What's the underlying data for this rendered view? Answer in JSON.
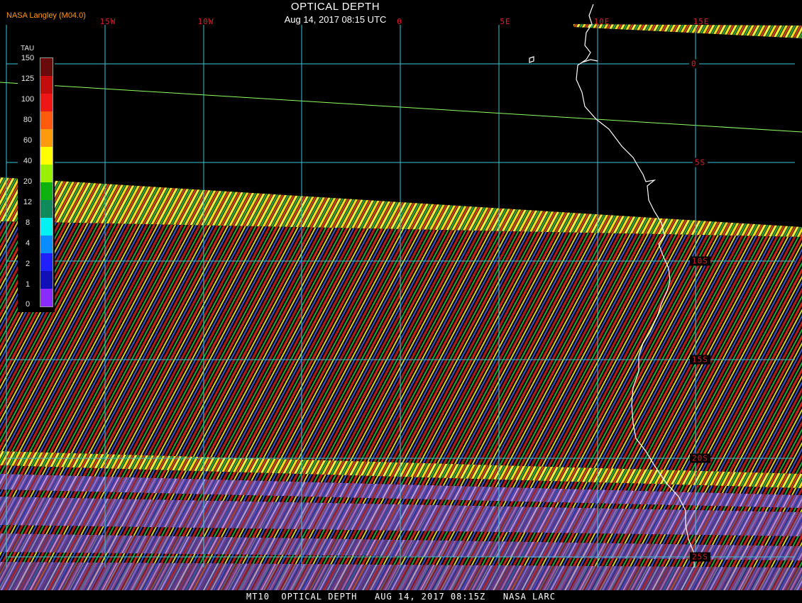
{
  "header": {
    "title": "OPTICAL DEPTH",
    "subtitle": "Aug 14, 2017 08:15 UTC",
    "credit": "NASA Langley (M04.0)"
  },
  "footer": {
    "text": "MT10  OPTICAL DEPTH   AUG 14, 2017 08:15Z   NASA LARC"
  },
  "grid": {
    "line_color": "#39c6d6",
    "longitude_labels": [
      "15W",
      "10W",
      "0",
      "5E",
      "10E",
      "15E"
    ],
    "latitude_labels": [
      "0",
      "5S",
      "10S",
      "15S",
      "20S",
      "25S"
    ]
  },
  "legend": {
    "unit": "TAU",
    "ticks": [
      "150",
      "125",
      "100",
      "80",
      "60",
      "40",
      "20",
      "12",
      "8",
      "4",
      "2",
      "1",
      "0"
    ],
    "colors": [
      "#6a0b0b",
      "#c40c0c",
      "#f01616",
      "#ff5a10",
      "#ff9a0a",
      "#ffff00",
      "#9af000",
      "#10b010",
      "#108a5a",
      "#00f2f2",
      "#0a8cff",
      "#2020ff",
      "#1010b4",
      "#8a2aff"
    ]
  },
  "palette": {
    "swath_primary": "#c0201c",
    "swath_secondary": "#20c040",
    "swath_bright": "#f0f020",
    "thin_swath": "#9a6ad8",
    "coastline": "#ffffff",
    "track": "#90ff60"
  }
}
